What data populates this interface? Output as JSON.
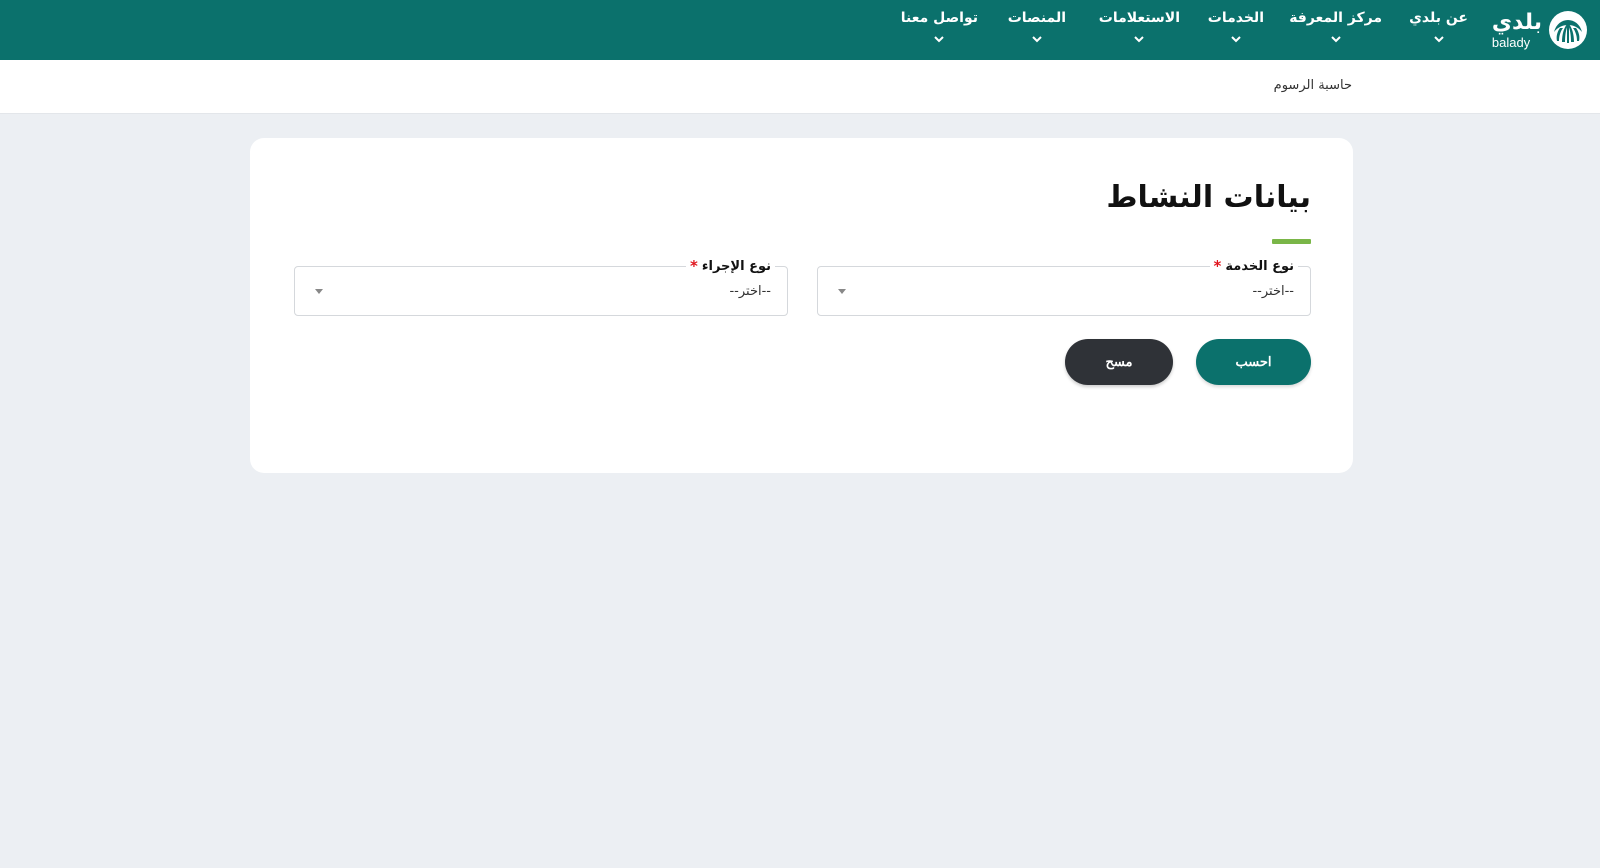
{
  "brand": {
    "name_ar": "بلدي",
    "name_en": "balady",
    "accent_color": "#0b716c",
    "logo_icon": "palm-tree-icon"
  },
  "nav": {
    "items": [
      {
        "label": "عن بلدي"
      },
      {
        "label": "مركز المعرفة"
      },
      {
        "label": "الخدمات"
      },
      {
        "label": "الاستعلامات"
      },
      {
        "label": "المنصات"
      },
      {
        "label": "تواصل معنا"
      }
    ]
  },
  "breadcrumb": {
    "current": "حاسبة الرسوم"
  },
  "form": {
    "title": "بيانات النشاط",
    "title_accent_color": "#7ab648",
    "service_type": {
      "label": "نوع الخدمة",
      "required_mark": "*",
      "value": "--اختر--"
    },
    "procedure_type": {
      "label": "نوع الإجراء",
      "required_mark": "*",
      "value": "--اختر--"
    },
    "calculate_label": "احسب",
    "clear_label": "مسح"
  }
}
